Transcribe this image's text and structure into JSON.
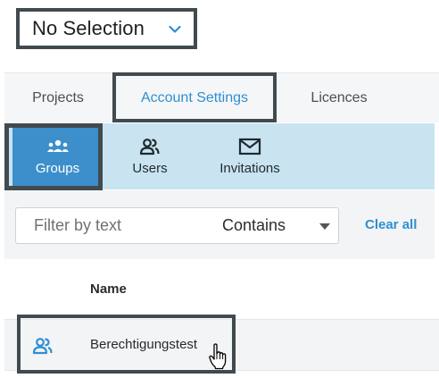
{
  "selection": {
    "value": "No Selection"
  },
  "tabs": [
    {
      "label": "Projects"
    },
    {
      "label": "Account Settings",
      "active": true
    },
    {
      "label": "Licences"
    }
  ],
  "subnav": [
    {
      "label": "Groups",
      "icon": "groups-icon",
      "active": true
    },
    {
      "label": "Users",
      "icon": "users-icon"
    },
    {
      "label": "Invitations",
      "icon": "envelope-icon"
    }
  ],
  "filter": {
    "placeholder": "Filter by text",
    "mode": "Contains",
    "clear_label": "Clear all"
  },
  "table": {
    "columns": [
      "Name"
    ],
    "rows": [
      {
        "name": "Berechtigungstest",
        "icon": "group-icon"
      }
    ]
  },
  "colors": {
    "accent": "#2f8fd2",
    "active_subnav": "#3c8fcb",
    "subnav_bg": "#c9e3f1",
    "highlight_frame": "#414a4f"
  }
}
